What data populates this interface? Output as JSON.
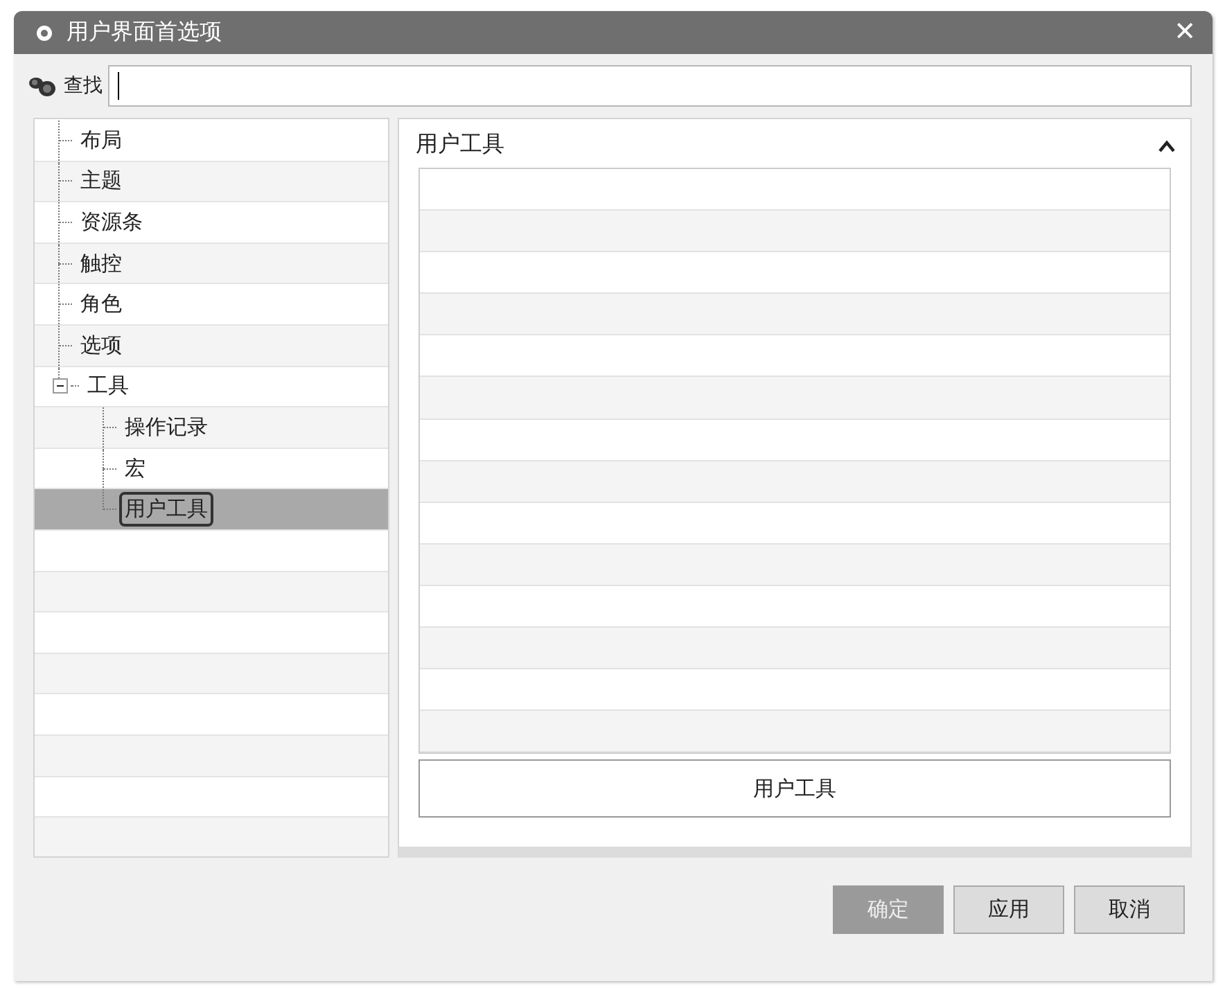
{
  "window": {
    "title": "用户界面首选项",
    "close": "✕"
  },
  "search": {
    "label": "查找"
  },
  "tree": [
    {
      "label": "布局",
      "selected": false
    },
    {
      "label": "主题",
      "selected": false
    },
    {
      "label": "资源条",
      "selected": false
    },
    {
      "label": "触控",
      "selected": false
    },
    {
      "label": "角色",
      "selected": false
    },
    {
      "label": "选项",
      "selected": false
    },
    {
      "label": "工具",
      "selected": false,
      "expanded": true,
      "children": [
        {
          "label": "操作记录",
          "selected": false
        },
        {
          "label": "宏",
          "selected": false
        },
        {
          "label": "用户工具",
          "selected": true
        }
      ]
    }
  ],
  "section": {
    "title": "用户工具",
    "expanded": true,
    "button": "用户工具"
  },
  "buttons": [
    {
      "label": "确定",
      "disabled": true
    },
    {
      "label": "应用",
      "disabled": false
    },
    {
      "label": "取消",
      "disabled": false
    }
  ]
}
